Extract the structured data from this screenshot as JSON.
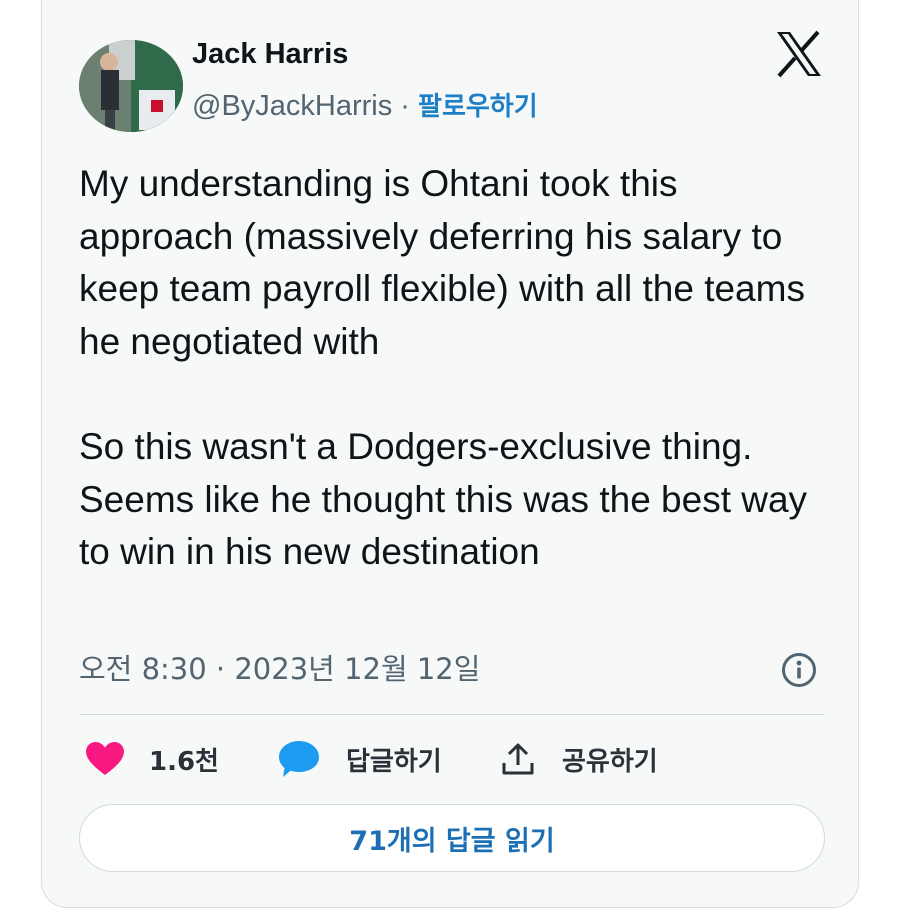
{
  "author": {
    "name": "Jack Harris",
    "handle": "@ByJackHarris",
    "separator": " · ",
    "follow_label": "팔로우하기"
  },
  "tweet": {
    "paragraphs": [
      "My understanding is Ohtani took this approach (massively deferring his salary to keep team payroll flexible) with all the teams he negotiated with",
      "So this wasn't a Dodgers-exclusive thing. Seems like he thought this was the best way to win in his new destination"
    ],
    "timestamp": "오전 8:30 · 2023년 12월 12일"
  },
  "actions": {
    "like_count": "1.6천",
    "reply_label": "답글하기",
    "share_label": "공유하기"
  },
  "read_replies_label": "71개의 답글 읽기",
  "icons": {
    "logo": "x-logo-icon",
    "info": "info-icon",
    "like": "heart-icon",
    "reply": "speech-bubble-icon",
    "share": "share-icon"
  },
  "colors": {
    "like": "#f91880",
    "reply": "#1d9bf0",
    "follow": "#1d7fc6",
    "link_button_text": "#1d6fb5"
  }
}
